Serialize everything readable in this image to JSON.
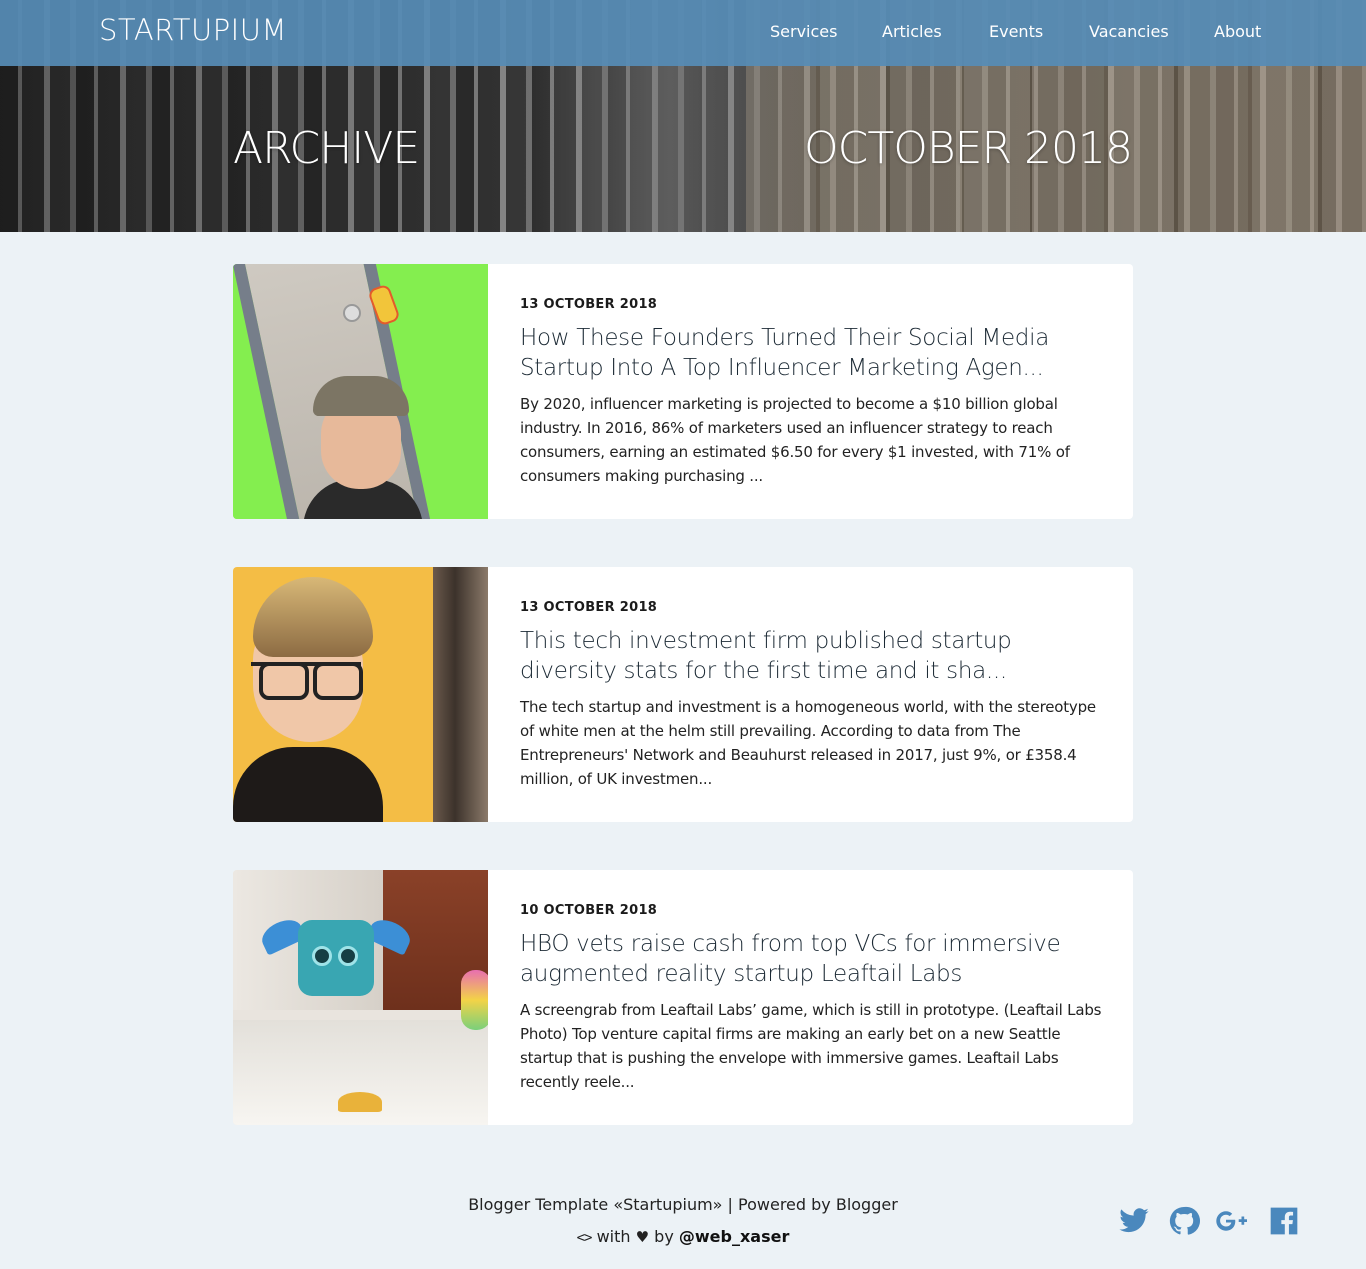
{
  "header": {
    "brand": "STARTUPIUM",
    "nav": [
      {
        "label": "Services"
      },
      {
        "label": "Articles"
      },
      {
        "label": "Events"
      },
      {
        "label": "Vacancies"
      },
      {
        "label": "About"
      }
    ]
  },
  "hero": {
    "left_title": "ARCHIVE",
    "right_title": "OCTOBER 2018"
  },
  "posts": [
    {
      "date": "13 OCTOBER 2018",
      "title": "How These Founders Turned Their Social Media Startup Into A Top Influencer Marketing Agen...",
      "excerpt": "By 2020, influencer marketing is projected to become a $10 billion global industry. In 2016, 86% of marketers used an influencer strategy to reach consumers, earning an estimated $6.50 for every $1 invested, with 71% of consumers making purchasing ..."
    },
    {
      "date": "13 OCTOBER 2018",
      "title": "This tech investment firm published startup diversity stats for the first time and it sha...",
      "excerpt": "The tech startup and investment is a homogeneous world, with the stereotype of white men at the helm still prevailing. According to data from The Entrepreneurs' Network and Beauhurst released in 2017, just 9%, or £358.4 million, of UK investmen..."
    },
    {
      "date": "10 OCTOBER 2018",
      "title": "HBO vets raise cash from top VCs for immersive augmented reality startup Leaftail Labs",
      "excerpt": "A screengrab from Leaftail Labs’ game, which is still in prototype. (Leaftail Labs Photo) Top venture capital firms are making an early bet on a new Seattle startup that is pushing the envelope with immersive games. Leaftail Labs recently reele..."
    }
  ],
  "footer": {
    "line1": "Blogger Template «Startupium» | Powered by Blogger",
    "code_glyph": "<>",
    "with_text": "with",
    "heart_glyph": "♥",
    "by_text": "by",
    "handle": "@web_xaser",
    "social_icons": [
      "twitter-icon",
      "github-icon",
      "google-plus-icon",
      "facebook-icon"
    ],
    "social_color": "#4a88bd"
  },
  "colors": {
    "nav_bg": "#568cb6",
    "page_bg": "#ecf2f6",
    "card_bg": "#ffffff"
  }
}
